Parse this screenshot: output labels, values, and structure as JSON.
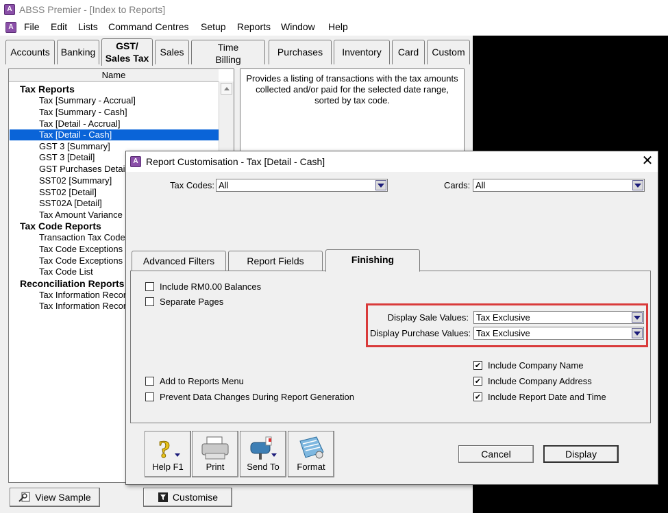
{
  "app": {
    "title": "ABSS Premier - [Index to Reports]",
    "icon_name": "abss-app-icon",
    "menu": [
      "File",
      "Edit",
      "Lists",
      "Command Centres",
      "Setup",
      "Reports",
      "Window",
      "Help"
    ]
  },
  "tabs": [
    {
      "label": "Accounts"
    },
    {
      "label": "Banking"
    },
    {
      "line1": "GST/",
      "line2": "Sales Tax"
    },
    {
      "label": "Sales"
    },
    {
      "line1": "Time",
      "line2": "Billing"
    },
    {
      "label": "Purchases"
    },
    {
      "label": "Inventory"
    },
    {
      "label": "Card"
    },
    {
      "label": "Custom"
    }
  ],
  "tree": {
    "header": "Name",
    "groups": {
      "tax_reports": "Tax Reports",
      "tax_code_reports": "Tax Code Reports",
      "reconciliation_reports": "Reconciliation Reports"
    },
    "tax_items": [
      "Tax [Summary - Accrual]",
      "Tax [Summary - Cash]",
      "Tax [Detail - Accrual]",
      "Tax [Detail - Cash]",
      "GST 3 [Summary]",
      "GST 3 [Detail]",
      "GST Purchases Detail",
      "SST02 [Summary]",
      "SST02 [Detail]",
      "SST02A [Detail]",
      "Tax Amount Variance"
    ],
    "tax_code_items": [
      "Transaction Tax Codes",
      "Tax Code Exceptions [",
      "Tax Code Exceptions [",
      "Tax Code List"
    ],
    "reconciliation_items": [
      "Tax Information Recor",
      "Tax Information Recor"
    ],
    "selected": "Tax [Detail - Cash]"
  },
  "description": "Provides a listing of transactions with the tax amounts collected and/or paid for the selected date range, sorted by tax code.",
  "bottom_buttons": {
    "view_sample": "View Sample",
    "customise": "Customise"
  },
  "dialog": {
    "title": "Report Customisation - Tax [Detail - Cash]",
    "tax_codes_label": "Tax Codes:",
    "tax_codes_value": "All",
    "cards_label": "Cards:",
    "cards_value": "All",
    "tabs": [
      "Advanced Filters",
      "Report Fields",
      "Finishing"
    ],
    "active_tab": "Finishing",
    "options": {
      "include_zero": {
        "label": "Include RM0.00 Balances",
        "checked": false
      },
      "separate_pages": {
        "label": "Separate Pages",
        "checked": false
      },
      "add_to_menu": {
        "label": "Add to Reports Menu",
        "checked": false
      },
      "prevent_changes": {
        "label": "Prevent Data Changes During Report Generation",
        "checked": false
      },
      "company_name": {
        "label": "Include Company Name",
        "checked": true
      },
      "company_address": {
        "label": "Include Company Address",
        "checked": true
      },
      "report_date": {
        "label": "Include Report Date and Time",
        "checked": true
      }
    },
    "display_sale_label": "Display Sale Values:",
    "display_sale_value": "Tax Exclusive",
    "display_purchase_label": "Display Purchase Values:",
    "display_purchase_value": "Tax Exclusive",
    "toolbar": {
      "help": "Help F1",
      "print": "Print",
      "send_to": "Send To",
      "format": "Format"
    },
    "cancel": "Cancel",
    "display": "Display"
  },
  "colors": {
    "selection": "#0a64d8",
    "highlight_box": "#d93a3a",
    "window_bg": "#f0f0f0"
  }
}
